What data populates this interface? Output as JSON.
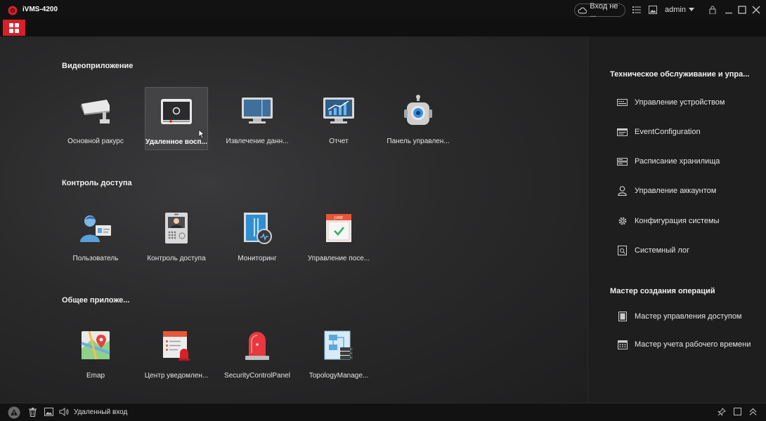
{
  "titlebar": {
    "app_title": "iVMS-4200",
    "login_label": "Вход не ...",
    "user_label": "admin",
    "icons": [
      "cloud-icon",
      "task-list-icon",
      "image-icon",
      "user-caret-icon",
      "lock-icon",
      "minimize-icon",
      "maximize-icon",
      "close-icon"
    ]
  },
  "colors": {
    "accent": "#d91f27",
    "background": "#2a2a2b",
    "panel": "#1e1e1f",
    "text": "#e6e6e6"
  },
  "sections": [
    {
      "title": "Видеоприложение",
      "apps": [
        {
          "label": "Основной ракурс",
          "icon": "camera-icon"
        },
        {
          "label": "Удаленное восп...",
          "icon": "playback-icon",
          "selected": true
        },
        {
          "label": "Извлечение данн...",
          "icon": "monitor-icon"
        },
        {
          "label": "Отчет",
          "icon": "report-chart-icon"
        },
        {
          "label": "Панель управлен...",
          "icon": "robot-panel-icon"
        }
      ]
    },
    {
      "title": "Контроль доступа",
      "apps": [
        {
          "label": "Пользователь",
          "icon": "person-card-icon"
        },
        {
          "label": "Контроль доступа",
          "icon": "intercom-icon"
        },
        {
          "label": "Мониторинг",
          "icon": "door-monitor-icon"
        },
        {
          "label": "Управление посе...",
          "icon": "calendar-icon"
        }
      ]
    },
    {
      "title": "Общее приложе...",
      "apps": [
        {
          "label": "Emap",
          "icon": "map-pin-icon"
        },
        {
          "label": "Центр уведомлен...",
          "icon": "notification-center-icon"
        },
        {
          "label": "SecurityControlPanel",
          "icon": "alarm-light-icon"
        },
        {
          "label": "TopologyManage...",
          "icon": "topology-icon"
        }
      ]
    }
  ],
  "side_panel": {
    "maintenance_title": "Техническое обслуживание и упра...",
    "maintenance_items": [
      {
        "label": "Управление устройством",
        "icon": "device-icon"
      },
      {
        "label": "EventConfiguration",
        "icon": "event-config-icon"
      },
      {
        "label": "Расписание хранилища",
        "icon": "storage-icon"
      },
      {
        "label": "Управление аккаунтом",
        "icon": "account-icon"
      },
      {
        "label": "Конфигурация системы",
        "icon": "gear-icon"
      },
      {
        "label": "Системный лог",
        "icon": "log-icon"
      }
    ],
    "wizard_title": "Мастер создания операций",
    "wizard_items": [
      {
        "label": "Мастер управления доступом",
        "icon": "access-wizard-icon"
      },
      {
        "label": "Мастер учета рабочего времени",
        "icon": "attendance-wizard-icon"
      }
    ]
  },
  "statusbar": {
    "text": "Удаленный вход",
    "icons": [
      "warning-icon",
      "trash-icon",
      "image-icon",
      "speaker-icon",
      "pin-icon",
      "window-icon",
      "collapse-up-icon"
    ]
  }
}
